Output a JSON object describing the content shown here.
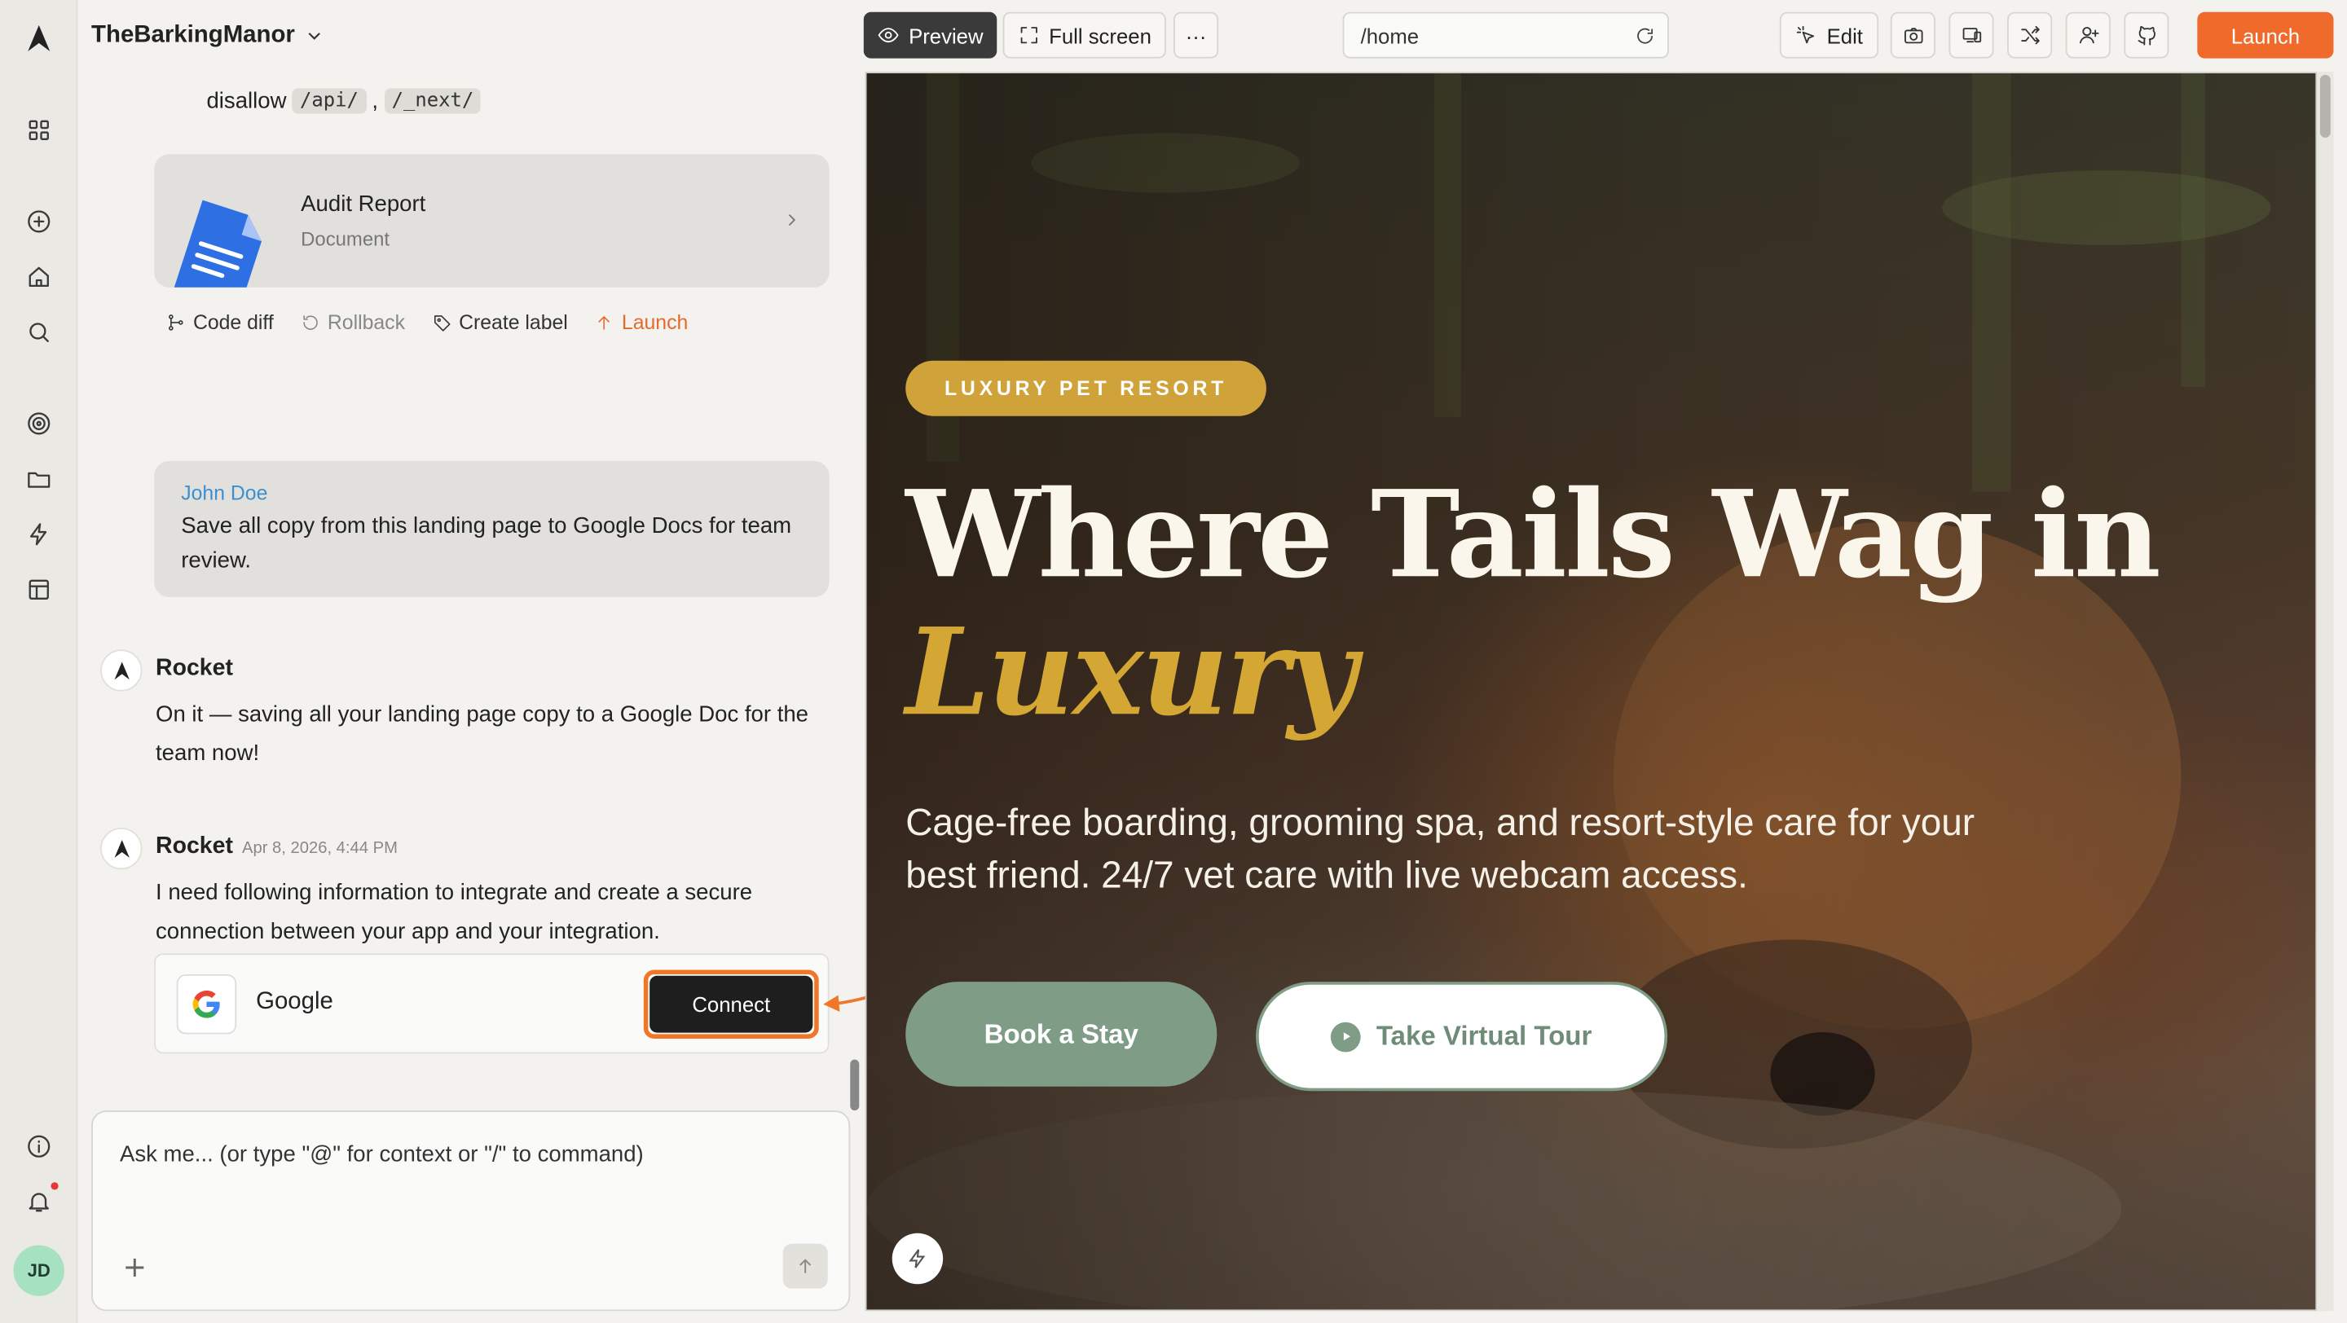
{
  "sidebar": {
    "icons": [
      "rocket-logo",
      "apps-icon",
      "plus-circle-icon",
      "home-icon",
      "search-icon",
      "target-icon",
      "folder-icon",
      "bolt-icon",
      "layout-icon",
      "info-icon",
      "bell-icon"
    ],
    "avatar_initials": "JD"
  },
  "project": {
    "name": "TheBarkingManor"
  },
  "chat": {
    "disallow_text": "disallow",
    "code_1": "/api/",
    "code_2": "/_next/",
    "doc_card": {
      "title": "Audit Report",
      "subtitle": "Document"
    },
    "actions": {
      "code_diff": "Code diff",
      "rollback": "Rollback",
      "create_label": "Create label",
      "launch": "Launch"
    },
    "user_message": {
      "name": "John Doe",
      "text": "Save all copy from this landing page to Google Docs for team review."
    },
    "bot_message_1": {
      "name": "Rocket",
      "text": "On it — saving all your landing page copy to a Google Doc for the team now!"
    },
    "bot_message_2": {
      "name": "Rocket",
      "time": "Apr 8, 2026, 4:44 PM",
      "text": "I need following information to integrate and create a secure connection between your app and your integration."
    },
    "integration": {
      "label": "Google",
      "connect": "Connect"
    }
  },
  "composer": {
    "placeholder": "Ask me... (or type \"@\" for context or \"/\" to command)"
  },
  "toolbar": {
    "preview": "Preview",
    "full_screen": "Full screen",
    "more": "···",
    "url": "/home",
    "edit": "Edit",
    "launch": "Launch"
  },
  "hero": {
    "badge": "LUXURY PET RESORT",
    "title_line1": "Where Tails Wag in",
    "title_line2": "Luxury",
    "subtitle": "Cage-free boarding, grooming spa, and resort-style care for your best friend. 24/7 vet care with live webcam access.",
    "book": "Book a Stay",
    "tour": "Take Virtual Tour"
  },
  "colors": {
    "accent": "#ef6a2b",
    "gold": "#d4a634",
    "sage": "#7f9c87"
  }
}
